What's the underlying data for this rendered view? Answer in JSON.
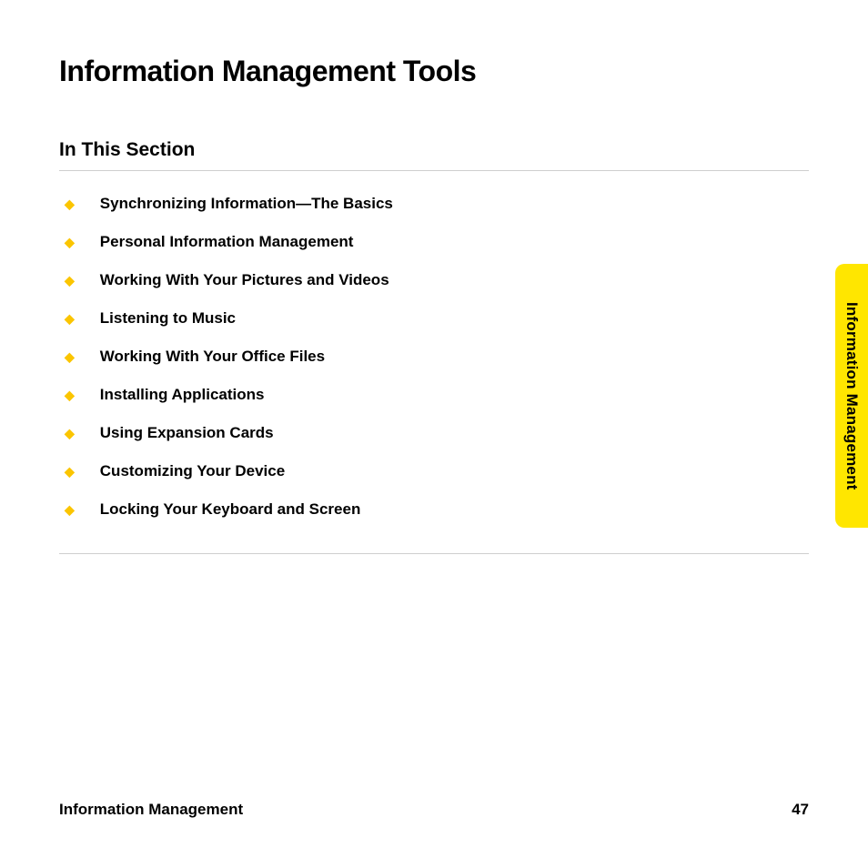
{
  "title": "Information Management Tools",
  "section_heading": "In This Section",
  "toc": [
    "Synchronizing Information—The Basics",
    "Personal Information Management",
    "Working With Your Pictures and Videos",
    "Listening to Music",
    "Working With Your Office Files",
    "Installing Applications",
    "Using Expansion Cards",
    "Customizing Your Device",
    "Locking Your Keyboard and Screen"
  ],
  "side_tab": "Information Management",
  "footer": {
    "section": "Information Management",
    "page": "47"
  }
}
